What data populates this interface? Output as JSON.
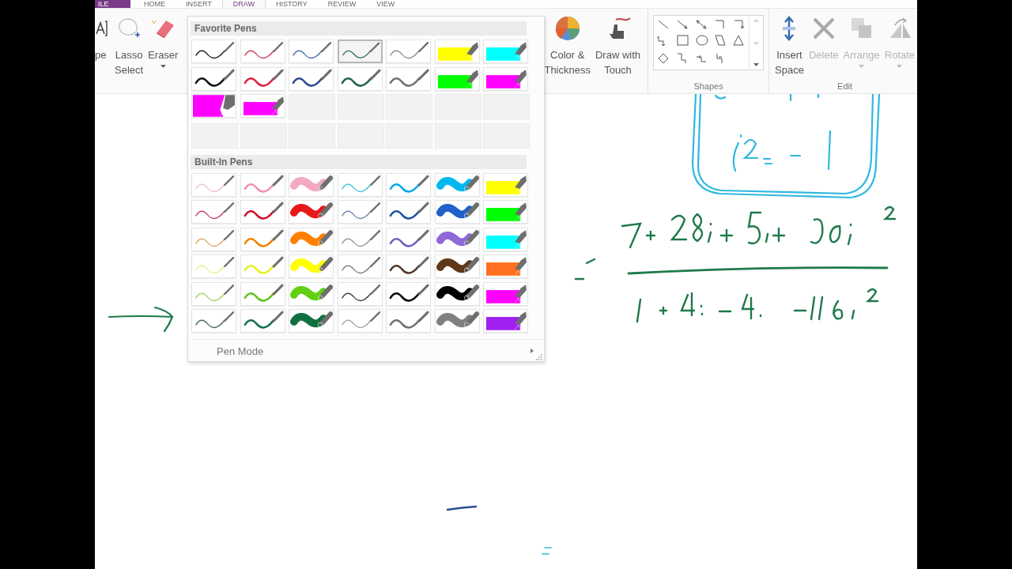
{
  "ribbon_tabs": [
    {
      "label": "ILE",
      "kind": "file",
      "selected": false
    },
    {
      "label": "HOME",
      "kind": "tab",
      "selected": false
    },
    {
      "label": "INSERT",
      "kind": "tab",
      "selected": false
    },
    {
      "label": "DRAW",
      "kind": "tab",
      "selected": true
    },
    {
      "label": "HISTORY",
      "kind": "tab",
      "selected": false
    },
    {
      "label": "REVIEW",
      "kind": "tab",
      "selected": false
    },
    {
      "label": "VIEW",
      "kind": "tab",
      "selected": false
    }
  ],
  "ribbon": {
    "tools": [
      {
        "kind": "type",
        "lines": [
          "pe"
        ],
        "dropdown": false,
        "disabled": false
      },
      {
        "kind": "lasso",
        "lines": [
          "Lasso",
          "Select"
        ],
        "dropdown": false,
        "disabled": false
      },
      {
        "kind": "eraser",
        "lines": [
          "Eraser"
        ],
        "dropdown": true,
        "disabled": false
      }
    ],
    "pen_tools": [
      {
        "kind": "color",
        "lines": [
          "Color &",
          "Thickness"
        ],
        "dropdown": false,
        "disabled": false
      },
      {
        "kind": "touch",
        "lines": [
          "Draw with",
          "Touch"
        ],
        "dropdown": false,
        "disabled": false
      }
    ],
    "shapes_group": {
      "label": "Shapes"
    },
    "edit_group": {
      "label": "Edit",
      "buttons": [
        {
          "kind": "insert-space",
          "lines": [
            "Insert",
            "Space"
          ],
          "dropdown": false,
          "disabled": false
        },
        {
          "kind": "delete",
          "lines": [
            "Delete"
          ],
          "dropdown": false,
          "disabled": true
        },
        {
          "kind": "arrange",
          "lines": [
            "Arrange"
          ],
          "dropdown": true,
          "disabled": true
        },
        {
          "kind": "rotate",
          "lines": [
            "Rotate"
          ],
          "dropdown": true,
          "disabled": true
        }
      ]
    }
  },
  "pen_gallery": {
    "favorites": {
      "heading": "Favorite Pens",
      "pens": [
        {
          "kind": "fine",
          "color": "#202020",
          "selected": false
        },
        {
          "kind": "fine",
          "color": "#d04060",
          "selected": false
        },
        {
          "kind": "fine",
          "color": "#5070b0",
          "selected": false
        },
        {
          "kind": "fine",
          "color": "#307060",
          "selected": true
        },
        {
          "kind": "fine",
          "color": "#909090",
          "selected": false
        },
        {
          "kind": "highlighter",
          "color": "#ffff00",
          "selected": false
        },
        {
          "kind": "highlighter",
          "color": "#00ffff",
          "selected": false
        },
        {
          "kind": "pen",
          "color": "#101010",
          "selected": false
        },
        {
          "kind": "pen",
          "color": "#e02040",
          "selected": false
        },
        {
          "kind": "pen",
          "color": "#304890",
          "selected": false
        },
        {
          "kind": "pen",
          "color": "#206050",
          "selected": false
        },
        {
          "kind": "pen",
          "color": "#707070",
          "selected": false
        },
        {
          "kind": "highlighter",
          "color": "#00ff00",
          "selected": false
        },
        {
          "kind": "highlighter",
          "color": "#ff00ff",
          "selected": false
        },
        {
          "kind": "chisel",
          "color": "#ff00ff",
          "selected": false
        },
        {
          "kind": "highlighter",
          "color": "#ff00ff",
          "selected": false
        },
        {
          "kind": "empty",
          "selected": false
        },
        {
          "kind": "empty",
          "selected": false
        },
        {
          "kind": "empty",
          "selected": false
        },
        {
          "kind": "empty",
          "selected": false
        },
        {
          "kind": "empty",
          "selected": false
        },
        {
          "kind": "empty",
          "selected": false
        },
        {
          "kind": "empty",
          "selected": false
        },
        {
          "kind": "empty",
          "selected": false
        },
        {
          "kind": "empty",
          "selected": false
        },
        {
          "kind": "empty",
          "selected": false
        },
        {
          "kind": "empty",
          "selected": false
        },
        {
          "kind": "empty",
          "selected": false
        }
      ]
    },
    "built_in": {
      "heading": "Built-In Pens",
      "pens": [
        {
          "kind": "fine",
          "color": "#f0c0cc",
          "selected": false
        },
        {
          "kind": "pen",
          "color": "#f090b0",
          "selected": false
        },
        {
          "kind": "brush",
          "color": "#f4a8c4",
          "selected": false
        },
        {
          "kind": "fine",
          "color": "#40c8d8",
          "selected": false
        },
        {
          "kind": "pen",
          "color": "#00a8e8",
          "selected": false
        },
        {
          "kind": "brush",
          "color": "#00b8f0",
          "selected": false
        },
        {
          "kind": "highlighter",
          "color": "#ffff00",
          "selected": false
        },
        {
          "kind": "fine",
          "color": "#c04868",
          "selected": false
        },
        {
          "kind": "pen",
          "color": "#d01030",
          "selected": false
        },
        {
          "kind": "brush",
          "color": "#e81818",
          "selected": false
        },
        {
          "kind": "fine",
          "color": "#7888a8",
          "selected": false
        },
        {
          "kind": "pen",
          "color": "#2050a0",
          "selected": false
        },
        {
          "kind": "brush",
          "color": "#2060c8",
          "selected": false
        },
        {
          "kind": "highlighter",
          "color": "#00ff00",
          "selected": false
        },
        {
          "kind": "fine",
          "color": "#e0a868",
          "selected": false
        },
        {
          "kind": "pen",
          "color": "#f08000",
          "selected": false
        },
        {
          "kind": "brush",
          "color": "#ff8000",
          "selected": false
        },
        {
          "kind": "fine",
          "color": "#989898",
          "selected": false
        },
        {
          "kind": "pen",
          "color": "#7060c0",
          "selected": false
        },
        {
          "kind": "brush",
          "color": "#9068d8",
          "selected": false
        },
        {
          "kind": "highlighter",
          "color": "#00ffff",
          "selected": false
        },
        {
          "kind": "fine",
          "color": "#e8f088",
          "selected": false
        },
        {
          "kind": "pen",
          "color": "#e8f020",
          "selected": false
        },
        {
          "kind": "brush",
          "color": "#ffff00",
          "selected": false
        },
        {
          "kind": "fine",
          "color": "#808080",
          "selected": false
        },
        {
          "kind": "pen",
          "color": "#503828",
          "selected": false
        },
        {
          "kind": "brush",
          "color": "#603818",
          "selected": false
        },
        {
          "kind": "highlighter",
          "color": "#ff7020",
          "selected": false
        },
        {
          "kind": "fine",
          "color": "#a8d068",
          "selected": false
        },
        {
          "kind": "pen",
          "color": "#60c020",
          "selected": false
        },
        {
          "kind": "brush",
          "color": "#60d010",
          "selected": false
        },
        {
          "kind": "fine",
          "color": "#404040",
          "selected": false
        },
        {
          "kind": "pen",
          "color": "#000000",
          "selected": false
        },
        {
          "kind": "brush",
          "color": "#000000",
          "selected": false
        },
        {
          "kind": "highlighter",
          "color": "#ff00ff",
          "selected": false
        },
        {
          "kind": "fine",
          "color": "#486868",
          "selected": false
        },
        {
          "kind": "pen",
          "color": "#107050",
          "selected": false
        },
        {
          "kind": "brush",
          "color": "#107040",
          "selected": false
        },
        {
          "kind": "fine",
          "color": "#a8a8a8",
          "selected": false
        },
        {
          "kind": "pen",
          "color": "#707070",
          "selected": false
        },
        {
          "kind": "brush",
          "color": "#808080",
          "selected": false
        },
        {
          "kind": "highlighter",
          "color": "#a020f0",
          "selected": false
        }
      ]
    },
    "pen_mode": {
      "label": "Pen Mode"
    }
  }
}
